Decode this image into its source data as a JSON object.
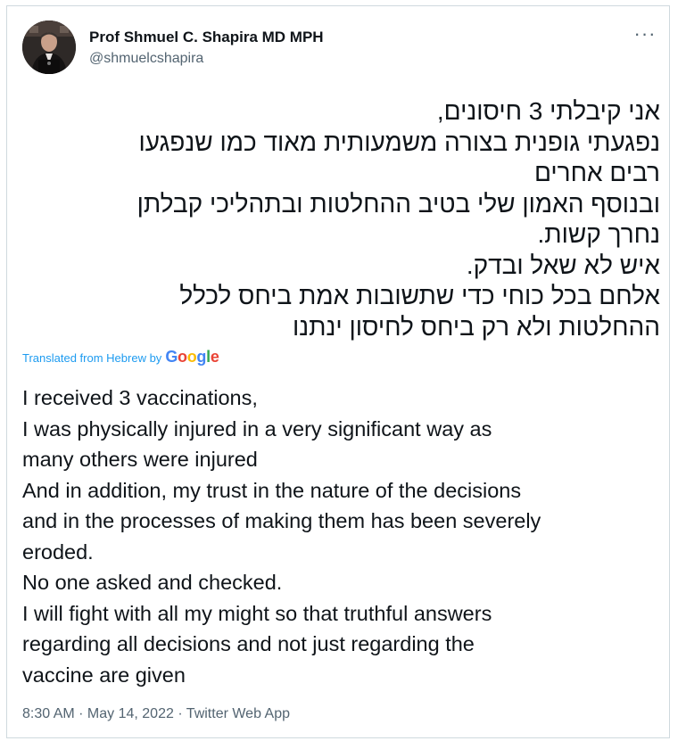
{
  "author": {
    "name": "Prof Shmuel C. Shapira MD MPH",
    "handle": "@shmuelcshapira"
  },
  "more_icon": "more-dots-icon",
  "hebrew_lines": [
    "אני קיבלתי 3 חיסונים,",
    "נפגעתי גופנית בצורה משמעותית מאוד כמו שנפגעו",
    "רבים אחרים",
    "ובנוסף האמון שלי בטיב ההחלטות ובתהליכי קבלתן",
    "נחרך קשות.",
    "איש לא שאל ובדק.",
    "אלחם בכל כוחי כדי שתשובות אמת ביחס לכלל",
    "ההחלטות ולא רק ביחס לחיסון ינתנו"
  ],
  "translation": {
    "label": "Translated from Hebrew by",
    "google": "Google",
    "google_colors": [
      "#4285f4",
      "#ea4335",
      "#fbbc05",
      "#4285f4",
      "#34a853",
      "#ea4335"
    ],
    "lines": [
      "I received 3 vaccinations,",
      " I was physically injured in a very significant way as",
      "many others were injured",
      " And in addition, my trust in the nature of the decisions",
      "and in the processes of making them has been severely",
      "eroded.",
      " No one asked and checked.",
      " I will fight with all my might so that truthful answers",
      "regarding all decisions and not just regarding the",
      "vaccine are given"
    ]
  },
  "meta": "8:30 AM · May 14, 2022 · Twitter Web App"
}
